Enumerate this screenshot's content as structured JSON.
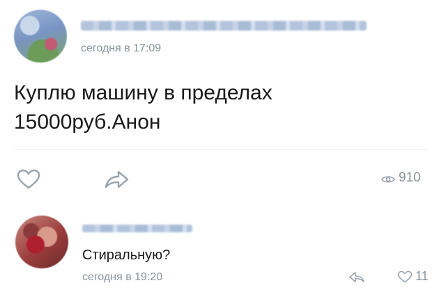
{
  "post": {
    "author_name": "",
    "timestamp": "сегодня в 17:09",
    "text_line1": "Куплю машину в пределах",
    "text_line2": "15000руб.Анон",
    "views": "910",
    "icons": [
      "heart-icon",
      "share-icon",
      "eye-icon"
    ]
  },
  "comment": {
    "author_name": "",
    "text": "Стиральную?",
    "timestamp": "сегодня в 19:20",
    "likes": "11",
    "icons": [
      "reply-icon",
      "heart-icon"
    ]
  },
  "colors": {
    "meta_gray": "#8b929c",
    "icon_blue_gray": "#99a2ad",
    "divider": "#e6e8eb"
  }
}
